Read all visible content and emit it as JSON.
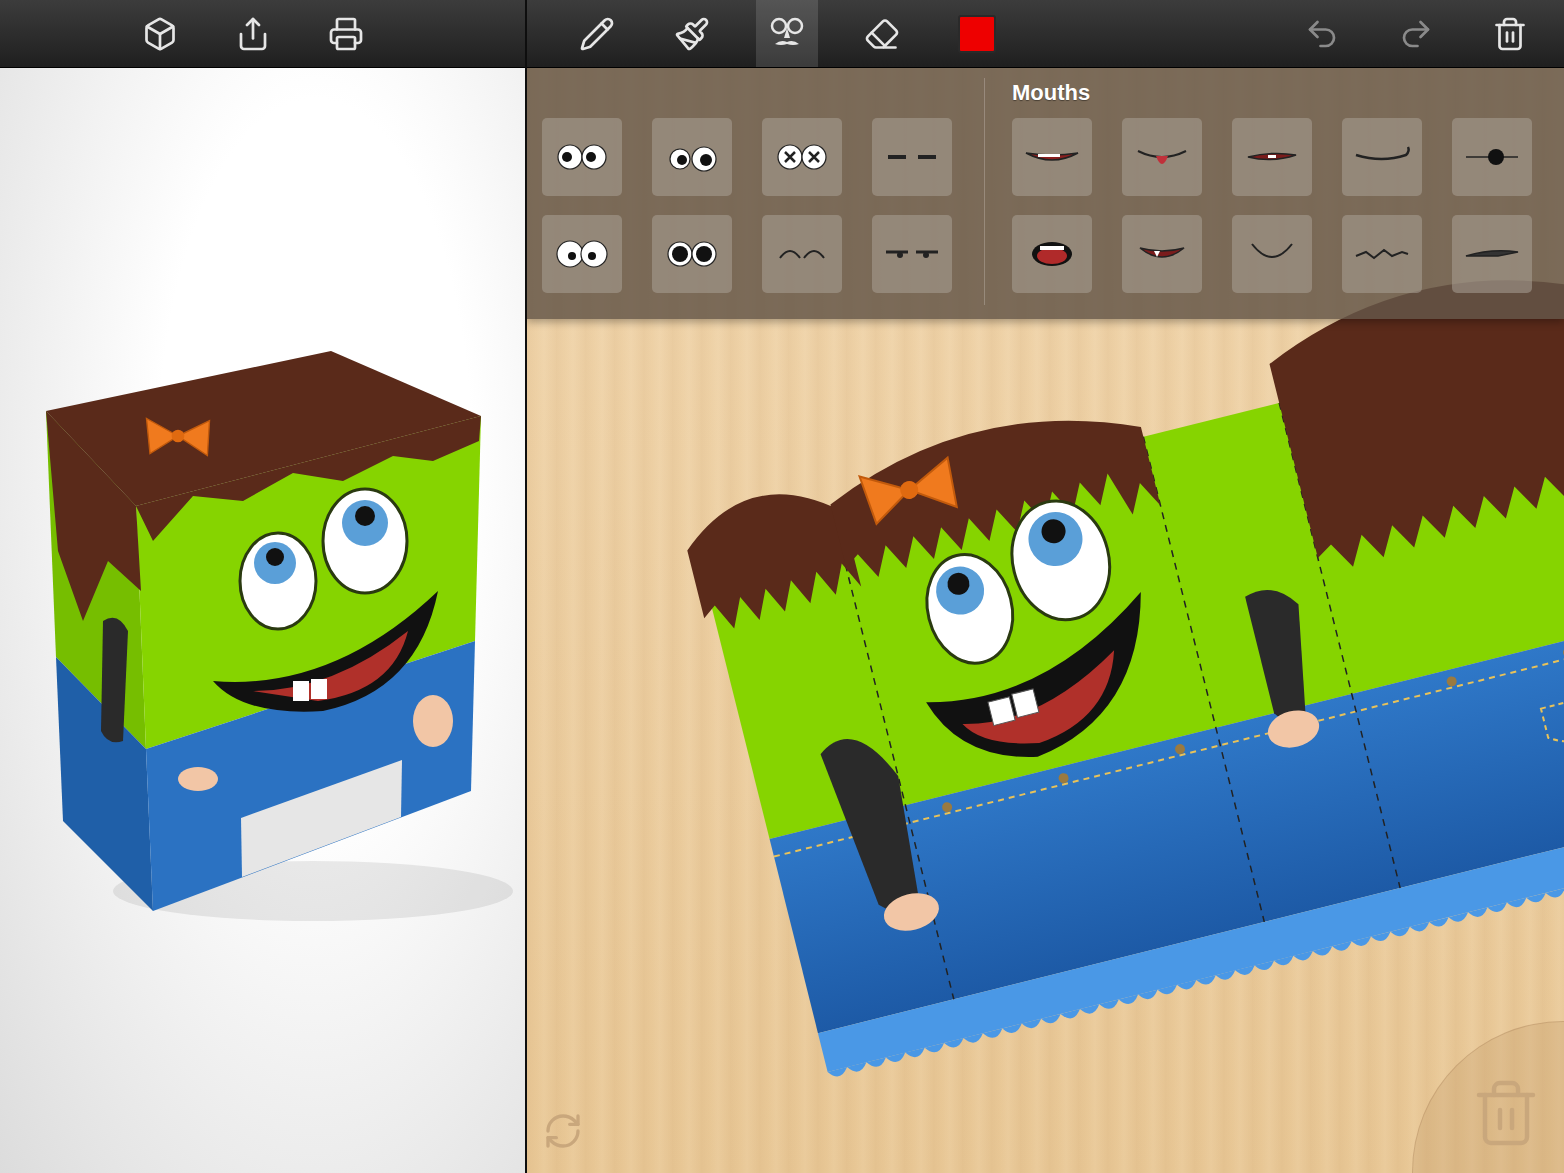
{
  "left_toolbar": {
    "tools": [
      {
        "kind": "view-3d",
        "selected": false
      },
      {
        "kind": "share",
        "selected": false
      },
      {
        "kind": "print",
        "selected": false
      }
    ]
  },
  "right_toolbar": {
    "tools": [
      {
        "kind": "pencil",
        "selected": false
      },
      {
        "kind": "brush",
        "selected": false
      },
      {
        "kind": "stickers",
        "selected": true
      },
      {
        "kind": "eraser",
        "selected": false
      }
    ],
    "color": "#ee0000",
    "actions": [
      {
        "kind": "undo",
        "disabled": true
      },
      {
        "kind": "redo",
        "disabled": true
      },
      {
        "kind": "clear",
        "disabled": false
      }
    ]
  },
  "picker": {
    "eyes": {
      "items": [
        {
          "kind": "round-left",
          "selected": false
        },
        {
          "kind": "round-right",
          "selected": false
        },
        {
          "kind": "crossed",
          "selected": false
        },
        {
          "kind": "dashes",
          "selected": false
        },
        {
          "kind": "wide",
          "selected": false
        },
        {
          "kind": "dark",
          "selected": false
        },
        {
          "kind": "closed",
          "selected": false
        },
        {
          "kind": "sleepy",
          "selected": false
        }
      ]
    },
    "mouths": {
      "label": "Mouths",
      "items": [
        {
          "kind": "grin",
          "selected": false
        },
        {
          "kind": "tongue",
          "selected": false
        },
        {
          "kind": "smirk",
          "selected": false
        },
        {
          "kind": "line",
          "selected": false
        },
        {
          "kind": "dot",
          "selected": false
        },
        {
          "kind": "open",
          "selected": false
        },
        {
          "kind": "fang",
          "selected": false
        },
        {
          "kind": "smile",
          "selected": false
        },
        {
          "kind": "zigzag",
          "selected": false
        },
        {
          "kind": "pout",
          "selected": false
        }
      ]
    }
  },
  "canvas": {
    "actions": [
      {
        "kind": "rotate"
      },
      {
        "kind": "trash"
      }
    ]
  }
}
